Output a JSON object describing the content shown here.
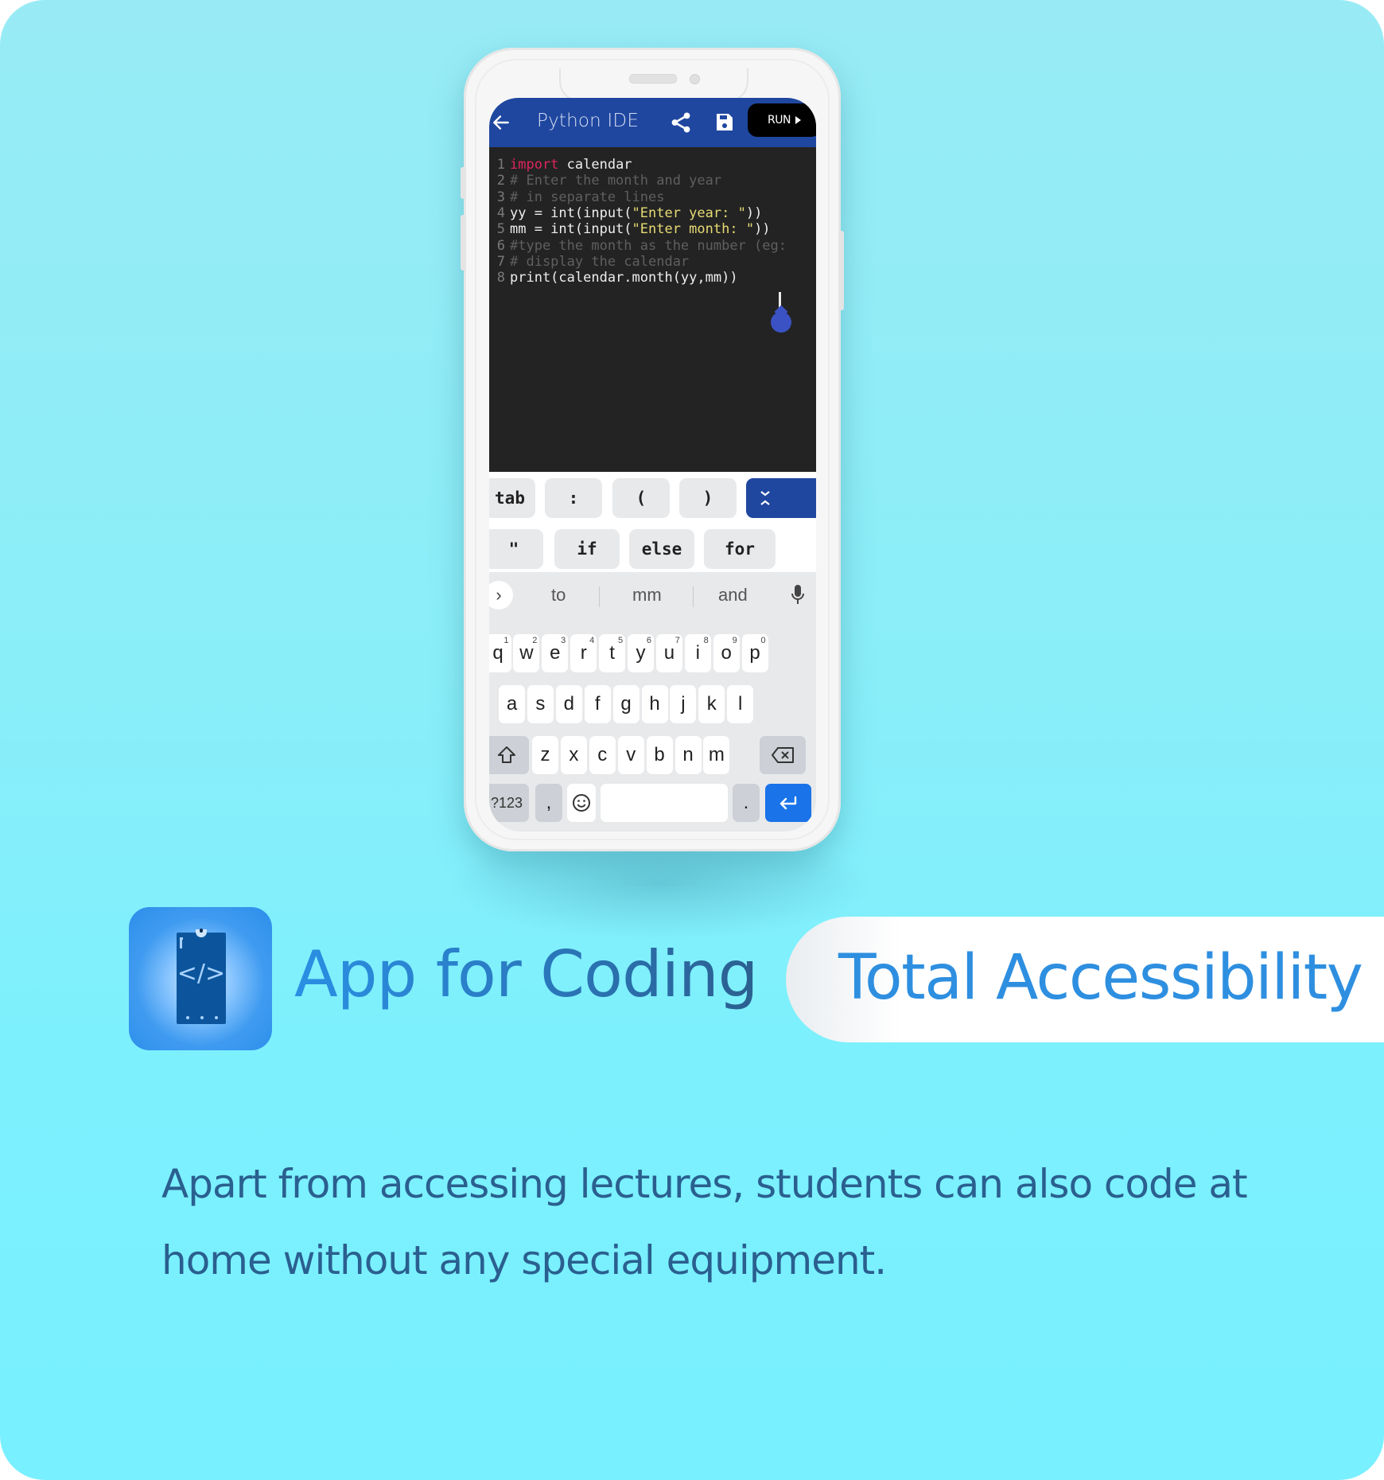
{
  "phone_app": {
    "title": "Python IDE",
    "back_icon": "arrow-left-icon",
    "share_icon": "share-icon",
    "save_icon": "floppy-disk-icon",
    "run_label": "RUN",
    "colors": {
      "appbar": "#1f47a0",
      "editor_bg": "#232323",
      "keyword": "#e0245e",
      "string": "#e6db74",
      "comment": "#5f5f5f",
      "enter_key": "#1a73e8"
    },
    "code_lines": [
      {
        "n": "1",
        "tokens": [
          {
            "t": "kw",
            "v": "import"
          },
          {
            "t": "plain",
            "v": " calendar"
          }
        ]
      },
      {
        "n": "2",
        "tokens": [
          {
            "t": "cmt",
            "v": "# Enter the month and year"
          }
        ]
      },
      {
        "n": "3",
        "tokens": [
          {
            "t": "cmt",
            "v": "# in separate lines"
          }
        ]
      },
      {
        "n": "4",
        "tokens": [
          {
            "t": "plain",
            "v": "yy = int(input("
          },
          {
            "t": "str",
            "v": "\"Enter year: \""
          },
          {
            "t": "plain",
            "v": "))"
          }
        ]
      },
      {
        "n": "5",
        "tokens": [
          {
            "t": "plain",
            "v": "mm = int(input("
          },
          {
            "t": "str",
            "v": "\"Enter month: \""
          },
          {
            "t": "plain",
            "v": "))"
          }
        ]
      },
      {
        "n": "6",
        "tokens": [
          {
            "t": "cmt",
            "v": "#type the month as the number (eg:"
          }
        ]
      },
      {
        "n": "7",
        "tokens": [
          {
            "t": "cmt",
            "v": "# display the calendar"
          }
        ]
      },
      {
        "n": "8",
        "tokens": [
          {
            "t": "plain",
            "v": "print(calendar.month(yy,mm))"
          }
        ]
      }
    ],
    "extra_keys_row1": [
      "tab",
      ":",
      "(",
      ")"
    ],
    "extra_keys_toggle_icon": "collapse-chevrons-icon",
    "extra_keys_row2": [
      "\"",
      "if",
      "else",
      "for"
    ],
    "suggestions": [
      "to",
      "mm",
      "and"
    ],
    "suggest_expand_icon": "chevron-right-icon",
    "mic_icon": "microphone-icon",
    "keyboard": {
      "row1": [
        {
          "k": "q",
          "h": "1"
        },
        {
          "k": "w",
          "h": "2"
        },
        {
          "k": "e",
          "h": "3"
        },
        {
          "k": "r",
          "h": "4"
        },
        {
          "k": "t",
          "h": "5"
        },
        {
          "k": "y",
          "h": "6"
        },
        {
          "k": "u",
          "h": "7"
        },
        {
          "k": "i",
          "h": "8"
        },
        {
          "k": "o",
          "h": "9"
        },
        {
          "k": "p",
          "h": "0"
        }
      ],
      "row2": [
        "a",
        "s",
        "d",
        "f",
        "g",
        "h",
        "j",
        "k",
        "l"
      ],
      "row3": [
        "z",
        "x",
        "c",
        "v",
        "b",
        "n",
        "m"
      ],
      "shift_icon": "shift-arrow-icon",
      "backspace_icon": "backspace-icon",
      "symbols_label": "?123",
      "comma_label": ",",
      "emoji_icon": "emoji-smile-icon",
      "period_label": ".",
      "enter_icon": "enter-return-icon"
    }
  },
  "feature": {
    "app_icon": "mobile-code-icon",
    "app_icon_glyph": "</>",
    "heading": "App for Coding",
    "badge": "Total Accessibility",
    "description": "Apart from accessing lectures, students can also code at home without any special equipment.",
    "colors": {
      "heading_start": "#2a8fe3",
      "heading_end": "#2b5f8f",
      "badge_text": "#2e8fe0",
      "description": "#2a5f8f",
      "background_top": "#98ebf5",
      "background_bottom": "#78f0ff"
    }
  }
}
